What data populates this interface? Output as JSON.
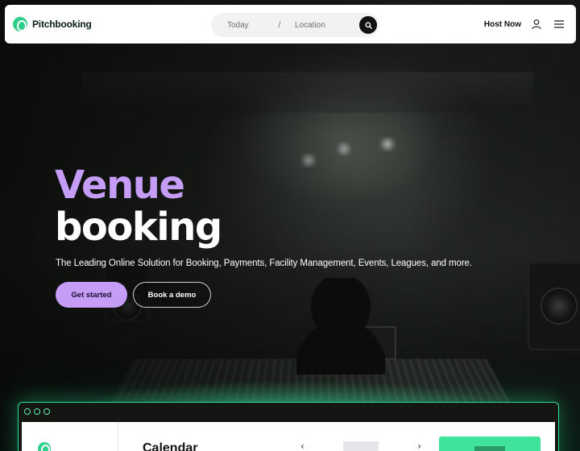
{
  "navbar": {
    "brand_name": "Pitchbooking",
    "search": {
      "when_label": "Today",
      "separator": "/",
      "where_label": "Location"
    },
    "host_now_label": "Host Now",
    "icons": [
      "search-icon",
      "user-icon",
      "menu-icon"
    ]
  },
  "hero": {
    "title_accent": "Venue",
    "title_main": "booking",
    "subtitle": "The Leading Online Solution for Booking, Payments, Facility Management, Events, Leagues, and more.",
    "primary_cta": "Get started",
    "secondary_cta": "Book a demo"
  },
  "preview": {
    "calendar_title": "Calendar",
    "prev_icon": "chevron-left-icon",
    "next_icon": "chevron-right-icon"
  },
  "colors": {
    "brand_green": "#2ecf8a",
    "accent_purple": "#c59cf6",
    "preview_border": "#2fe09a",
    "panel_green": "#3fe39c"
  }
}
